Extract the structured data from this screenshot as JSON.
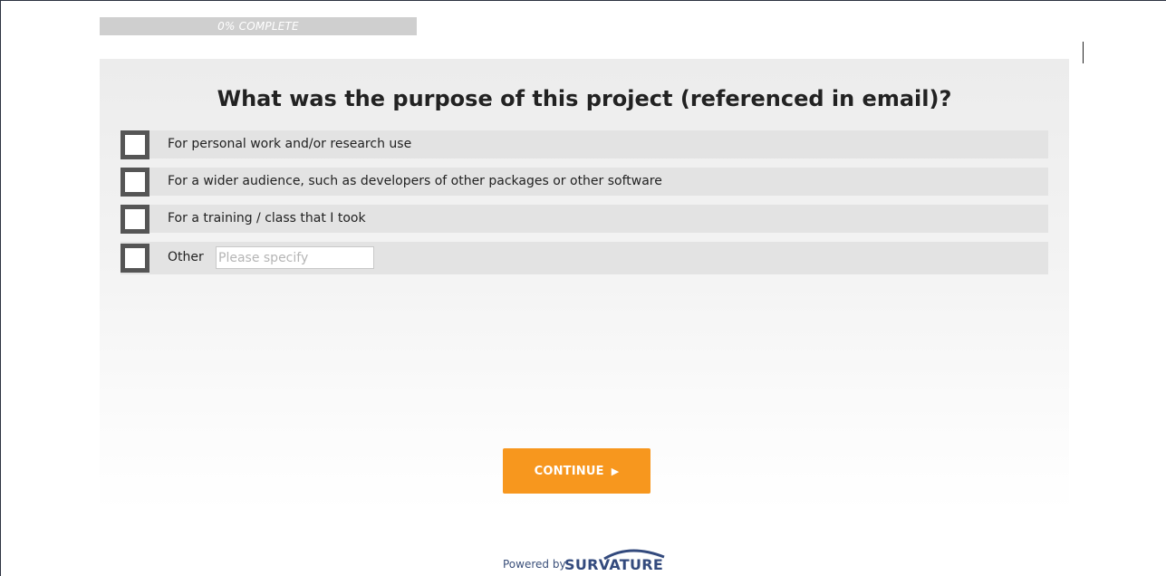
{
  "progress": {
    "label": "0% COMPLETE",
    "percent": 0
  },
  "question": {
    "title": "What was the purpose of this project (referenced in email)?",
    "options": [
      {
        "label": "For personal work and/or research use",
        "checked": false
      },
      {
        "label": "For a wider audience, such as developers of other packages or other software",
        "checked": false
      },
      {
        "label": "For a training / class that I took",
        "checked": false
      },
      {
        "label": "Other",
        "checked": false
      }
    ],
    "other_placeholder": "Please specify",
    "other_value": ""
  },
  "continue": {
    "label": "CONTINUE",
    "icon": "play-arrow-icon"
  },
  "footer": {
    "powered_by": "Powered by",
    "brand": "SURVATURE"
  },
  "colors": {
    "accent": "#f7971e",
    "brand": "#334a7d",
    "checkbox_border": "#555555"
  }
}
